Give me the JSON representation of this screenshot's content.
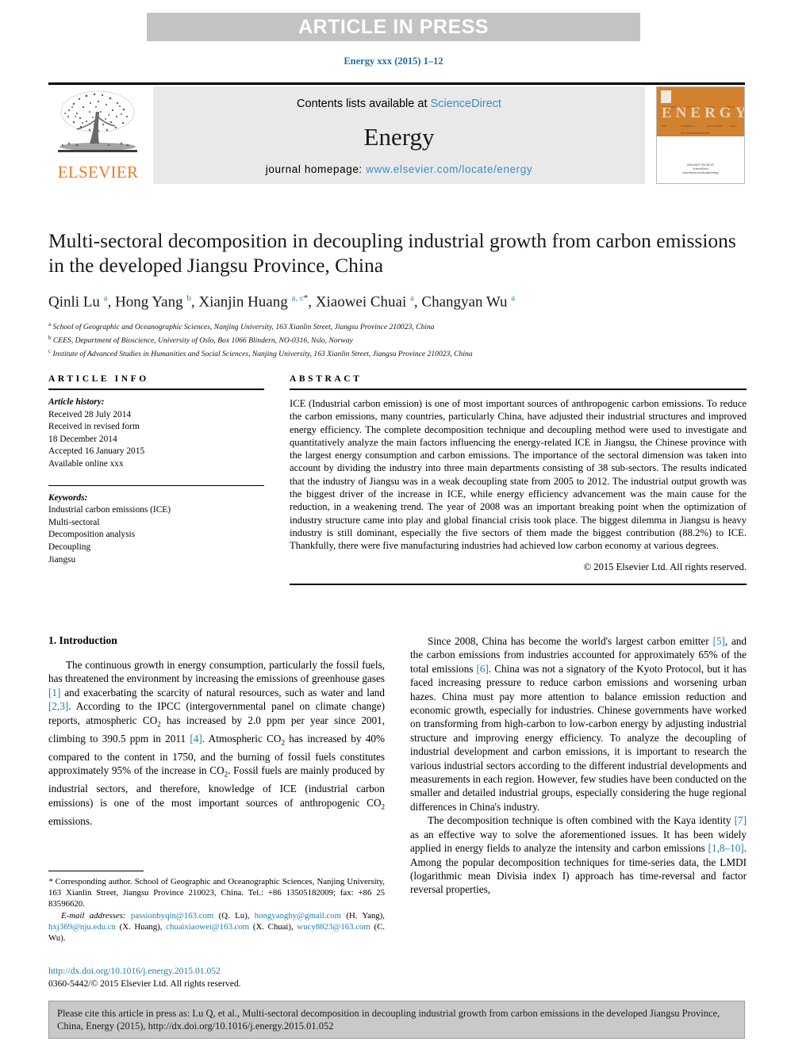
{
  "banner": {
    "label": "ARTICLE IN PRESS"
  },
  "journal_ref": "Energy xxx (2015) 1–12",
  "masthead": {
    "contents_prefix": "Contents lists available at ",
    "contents_link": "ScienceDirect",
    "journal_name": "Energy",
    "homepage_prefix": "journal homepage: ",
    "homepage_link": "www.elsevier.com/locate/energy",
    "publisher_name": "ELSEVIER",
    "cover_title": "ENERGY",
    "cover_caption": "An International Journal"
  },
  "article": {
    "title": "Multi-sectoral decomposition in decoupling industrial growth from carbon emissions in the developed Jiangsu Province, China",
    "authors_html": "Qinli Lu <sup>a</sup>, Hong Yang <sup>b</sup>, Xianjin Huang <sup>a, c</sup><sup class=\"star\">*</sup>, Xiaowei Chuai <sup>a</sup>, Changyan Wu <sup>a</sup>",
    "affiliations": [
      {
        "mark": "a",
        "text": "School of Geographic and Oceanographic Sciences, Nanjing University, 163 Xianlin Street, Jiangsu Province 210023, China"
      },
      {
        "mark": "b",
        "text": "CEES, Department of Bioscience, University of Oslo, Box 1066 Blindern, NO-0316, Nslo, Norway"
      },
      {
        "mark": "c",
        "text": "Institute of Advanced Studies in Humanities and Social Sciences, Nanjing University, 163 Xianlin Street, Jiangsu Province 210023, China"
      }
    ]
  },
  "info": {
    "heading": "ARTICLE INFO",
    "history_label": "Article history:",
    "history_lines": [
      "Received 28 July 2014",
      "Received in revised form",
      "18 December 2014",
      "Accepted 16 January 2015",
      "Available online xxx"
    ],
    "keywords_label": "Keywords:",
    "keywords": [
      "Industrial carbon emissions (ICE)",
      "Multi-sectoral",
      "Decomposition analysis",
      "Decoupling",
      "Jiangsu"
    ]
  },
  "abstract": {
    "heading": "ABSTRACT",
    "text": "ICE (Industrial carbon emission) is one of most important sources of anthropogenic carbon emissions. To reduce the carbon emissions, many countries, particularly China, have adjusted their industrial structures and improved energy efficiency. The complete decomposition technique and decoupling method were used to investigate and quantitatively analyze the main factors influencing the energy-related ICE in Jiangsu, the Chinese province with the largest energy consumption and carbon emissions. The importance of the sectoral dimension was taken into account by dividing the industry into three main departments consisting of 38 sub-sectors. The results indicated that the industry of Jiangsu was in a weak decoupling state from 2005 to 2012. The industrial output growth was the biggest driver of the increase in ICE, while energy efficiency advancement was the main cause for the reduction, in a weakening trend. The year of 2008 was an important breaking point when the optimization of industry structure came into play and global financial crisis took place. The biggest dilemma in Jiangsu is heavy industry is still dominant, especially the five sectors of them made the biggest contribution (88.2%) to ICE. Thankfully, there were five manufacturing industries had achieved low carbon economy at various degrees.",
    "copyright": "© 2015 Elsevier Ltd. All rights reserved."
  },
  "body": {
    "section_heading": "1. Introduction",
    "left_para_1_html": "The continuous growth in energy consumption, particularly the fossil fuels, has threatened the environment by increasing the emissions of greenhouse gases <span class=\"ref\">[1]</span> and exacerbating the scarcity of natural resources, such as water and land <span class=\"ref\">[2,3]</span>. According to the IPCC (intergovernmental panel on climate change) reports, atmospheric CO<sub>2</sub> has increased by 2.0 ppm per year since 2001, climbing to 390.5 ppm in 2011 <span class=\"ref\">[4]</span>. Atmospheric CO<sub>2</sub> has increased by 40% compared to the content in 1750, and the burning of fossil fuels constitutes approximately 95% of the increase in CO<sub>2</sub>. Fossil fuels are mainly produced by industrial sectors, and therefore, knowledge of ICE (industrial carbon emissions) is one of the most important sources of anthropogenic CO<sub>2</sub> emissions.",
    "right_para_1_html": "Since 2008, China has become the world's largest carbon emitter <span class=\"ref\">[5]</span>, and the carbon emissions from industries accounted for approximately 65% of the total emissions <span class=\"ref\">[6]</span>. China was not a signatory of the Kyoto Protocol, but it has faced increasing pressure to reduce carbon emissions and worsening urban hazes. China must pay more attention to balance emission reduction and economic growth, especially for industries. Chinese governments have worked on transforming from high-carbon to low-carbon energy by adjusting industrial structure and improving energy efficiency. To analyze the decoupling of industrial development and carbon emissions, it is important to research the various industrial sectors according to the different industrial developments and measurements in each region. However, few studies have been conducted on the smaller and detailed industrial groups, especially considering the huge regional differences in China's industry.",
    "right_para_2_html": "The decomposition technique is often combined with the Kaya identity <span class=\"ref\">[7]</span> as an effective way to solve the aforementioned issues. It has been widely applied in energy fields to analyze the intensity and carbon emissions <span class=\"ref\">[1,8&#8211;10]</span>. Among the popular decomposition techniques for time-series data, the LMDI (logarithmic mean Divisia index I) approach has time-reversal and factor reversal properties,"
  },
  "footnote": {
    "corresponding_html": "<span class=\"em\">*</span> Corresponding author. School of Geographic and Oceanographic Sciences, Nanjing University, 163 Xianlin Street, Jiangsu Province 210023, China. Tel.: +86 13505182009; fax: +86 25 83596620.",
    "emails_html": "<span class=\"em\">E-mail addresses:</span> <span class=\"fn-link\">passionbyqin@163.com</span> (Q. Lu), <span class=\"fn-link\">hongyanghy@gmail.com</span> (H. Yang), <span class=\"fn-link\">hxj369@nju.edu.cn</span> (X. Huang), <span class=\"fn-link\">chuaixiaowei@163.com</span> (X. Chuai), <span class=\"fn-link\">wucy8823@163.com</span> (C. Wu)."
  },
  "doi_block": {
    "doi": "http://dx.doi.org/10.1016/j.energy.2015.01.052",
    "issn": "0360-5442/© 2015 Elsevier Ltd. All rights reserved."
  },
  "cite_box": {
    "text": "Please cite this article in press as: Lu Q, et al., Multi-sectoral decomposition in decoupling industrial growth from carbon emissions in the developed Jiangsu Province, China, Energy (2015), http://dx.doi.org/10.1016/j.energy.2015.01.052"
  },
  "colors": {
    "link": "#1a7db5",
    "banner_bg": "#c3c3c4",
    "masthead_bg": "#e9e9e9",
    "elsevier_orange": "#ec7c26",
    "cover_orange": "#d2812f",
    "cite_bg": "#c9c9c9"
  }
}
